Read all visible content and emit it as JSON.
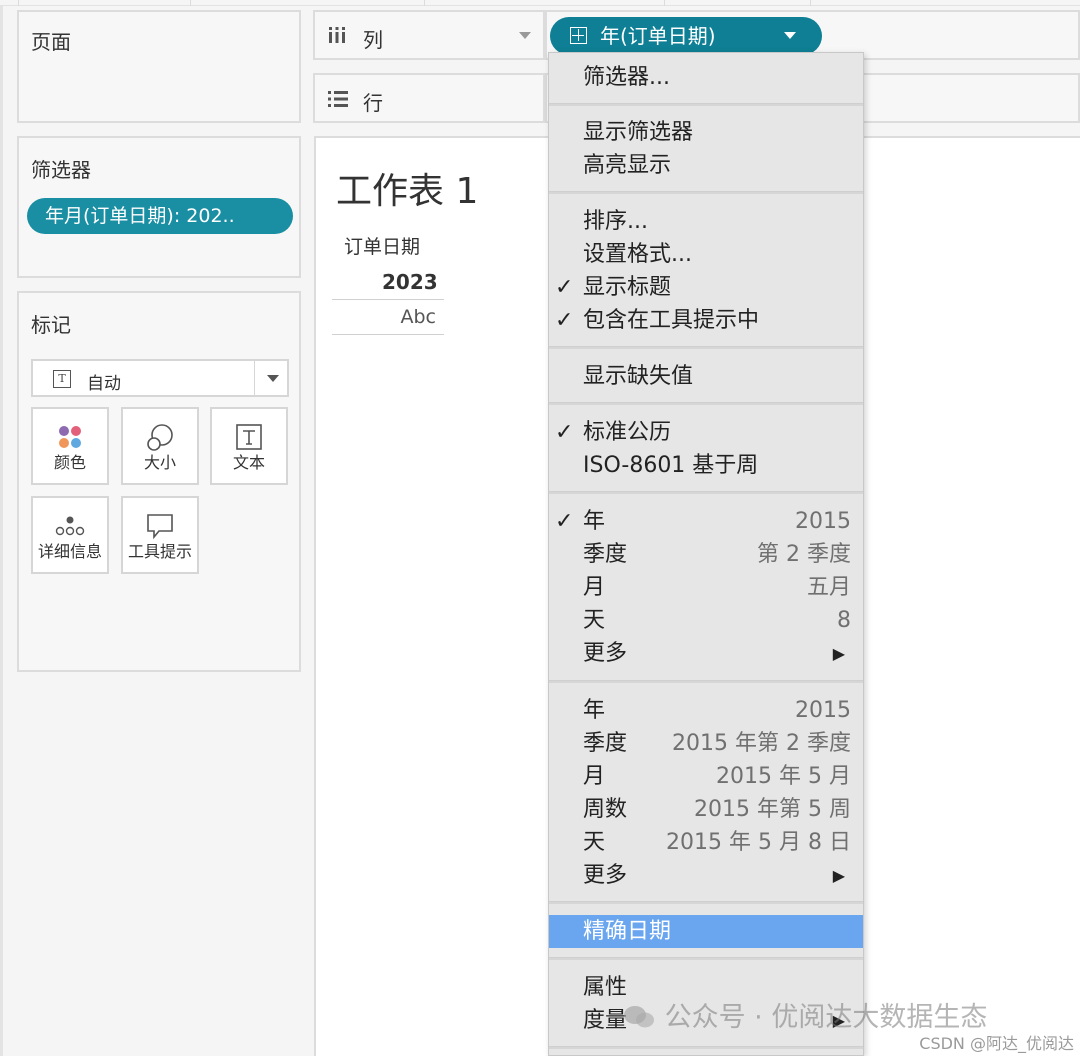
{
  "pages_panel": {
    "title": "页面"
  },
  "filters_panel": {
    "title": "筛选器",
    "pill": "年月(订单日期): 202.."
  },
  "marks_panel": {
    "title": "标记",
    "mark_type": "自动",
    "buttons": [
      "颜色",
      "大小",
      "文本",
      "详细信息",
      "工具提示"
    ]
  },
  "columns_shelf": {
    "label": "列",
    "pill": "年(订单日期)"
  },
  "rows_shelf": {
    "label": "行"
  },
  "sheet": {
    "title": "工作表 1",
    "column_header": "订单日期",
    "year_value": "2023",
    "cell_value": "Abc"
  },
  "menu": {
    "items": [
      {
        "label": "筛选器...",
        "check": "",
        "value": ""
      },
      {
        "label": "显示筛选器",
        "check": "",
        "value": ""
      },
      {
        "label": "高亮显示",
        "check": "",
        "value": ""
      },
      {
        "label": "排序...",
        "check": "",
        "value": ""
      },
      {
        "label": "设置格式...",
        "check": "",
        "value": ""
      },
      {
        "label": "显示标题",
        "check": "✓",
        "value": ""
      },
      {
        "label": "包含在工具提示中",
        "check": "✓",
        "value": ""
      },
      {
        "label": "显示缺失值",
        "check": "",
        "value": ""
      },
      {
        "label": "标准公历",
        "check": "✓",
        "value": ""
      },
      {
        "label": "ISO-8601 基于周",
        "check": "",
        "value": ""
      },
      {
        "label": "年",
        "check": "✓",
        "value": "2015"
      },
      {
        "label": "季度",
        "check": "",
        "value": "第 2 季度"
      },
      {
        "label": "月",
        "check": "",
        "value": "五月"
      },
      {
        "label": "天",
        "check": "",
        "value": "8"
      },
      {
        "label": "更多",
        "check": "",
        "value": "▶"
      },
      {
        "label": "年",
        "check": "",
        "value": "2015"
      },
      {
        "label": "季度",
        "check": "",
        "value": "2015 年第 2 季度"
      },
      {
        "label": "月",
        "check": "",
        "value": "2015 年 5 月"
      },
      {
        "label": "周数",
        "check": "",
        "value": "2015 年第 5 周"
      },
      {
        "label": "天",
        "check": "",
        "value": "2015 年 5 月 8 日"
      },
      {
        "label": "更多",
        "check": "",
        "value": "▶"
      },
      {
        "label": "精确日期",
        "check": "",
        "value": ""
      },
      {
        "label": "属性",
        "check": "",
        "value": ""
      },
      {
        "label": "度量",
        "check": "",
        "value": "▶"
      }
    ]
  },
  "watermark": {
    "text": "公众号 · 优阅达大数据生态",
    "credit": "CSDN @阿达_优阅达"
  }
}
